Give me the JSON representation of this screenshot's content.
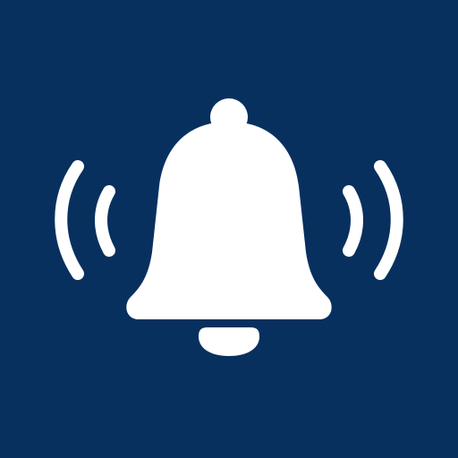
{
  "icon": {
    "name": "ringing-bell-icon",
    "background_color": "#07305f",
    "glyph_color": "#ffffff"
  }
}
